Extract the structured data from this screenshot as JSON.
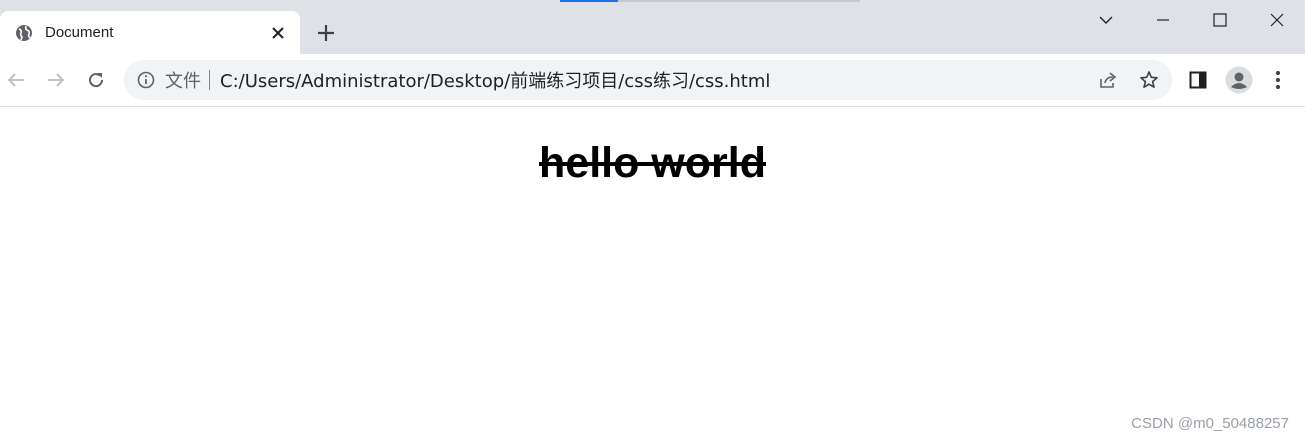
{
  "tab": {
    "title": "Document",
    "close_icon": "close-icon",
    "favicon": "globe-icon"
  },
  "new_tab_icon": "plus-icon",
  "window_controls": [
    "chevron-down-icon",
    "minimize-icon",
    "maximize-icon",
    "close-icon"
  ],
  "toolbar": {
    "back_icon": "arrow-left-icon",
    "forward_icon": "arrow-right-icon",
    "reload_icon": "reload-icon",
    "scheme_label": "文件",
    "url": "C:/Users/Administrator/Desktop/前端练习项目/css练习/css.html",
    "share_icon": "share-icon",
    "bookmark_icon": "star-icon",
    "side_panel_icon": "side-panel-icon",
    "profile_icon": "avatar-icon",
    "menu_icon": "kebab-menu-icon"
  },
  "page": {
    "heading": "hello world"
  },
  "watermark": "CSDN @m0_50488257",
  "colors": {
    "tabstrip": "#dee1e6",
    "omnibox": "#f1f3f4",
    "accent": "#1a73e8"
  }
}
